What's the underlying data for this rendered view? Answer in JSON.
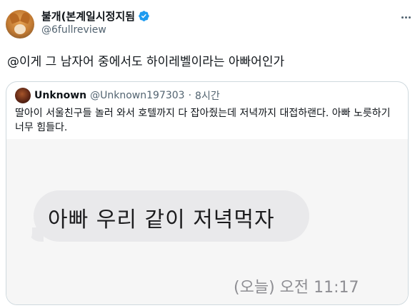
{
  "tweet": {
    "display_name": "불개(본계일시정지됨",
    "handle": "@6fullreview",
    "text": "@이게 그 남자어 중에서도 하이레벨이라는 아빠어인가"
  },
  "quote": {
    "name": "Unknown",
    "handle": "@Unknown197303",
    "separator": "·",
    "time": "8시간",
    "text": "딸아이 서울친구들 놀러 와서 호텔까지 다 잡아줬는데 저녁까지 대접하랜다. 아빠 노릇하기 너무 힘들다."
  },
  "photo": {
    "bubble_text": "아빠 우리 같이 저녁먹자",
    "timestamp": "(오늘) 오전 11:17"
  },
  "colors": {
    "verified": "#1d9bf0",
    "secondary_text": "#536471",
    "border": "#cfd9de",
    "bubble": "#e9e9eb"
  },
  "icons": {
    "verified": "verified-badge-icon",
    "more": "more-options-icon"
  }
}
